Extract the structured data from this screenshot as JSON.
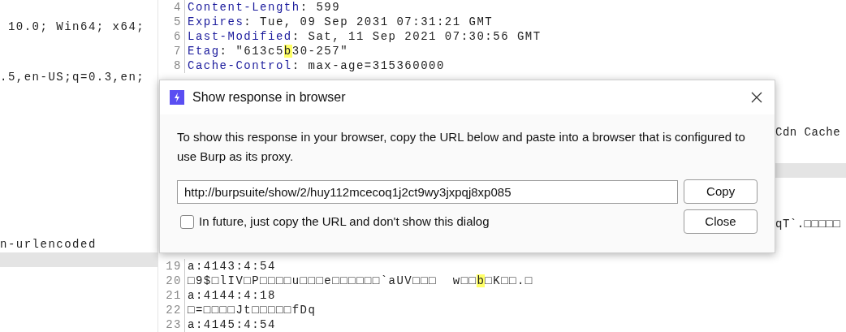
{
  "request_pane": {
    "lines": [
      {
        "text": " 10.0; Win64; x64;"
      },
      {
        "text": ".5,en-US;q=0.3,en;"
      },
      {
        "text": "n-urlencoded"
      }
    ]
  },
  "response_pane": {
    "top_lines": [
      {
        "number": "4",
        "segments": [
          {
            "kind": "name",
            "text": "Content-Length"
          },
          {
            "kind": "value",
            "text": ": 599"
          }
        ]
      },
      {
        "number": "5",
        "segments": [
          {
            "kind": "name",
            "text": "Expires"
          },
          {
            "kind": "value",
            "text": ": Tue, 09 Sep 2031 07:31:21 GMT"
          }
        ]
      },
      {
        "number": "6",
        "segments": [
          {
            "kind": "name",
            "text": "Last-Modified"
          },
          {
            "kind": "value",
            "text": ": Sat, 11 Sep 2021 07:30:56 GMT"
          }
        ]
      },
      {
        "number": "7",
        "segments": [
          {
            "kind": "name",
            "text": "Etag"
          },
          {
            "kind": "value",
            "text": ": \"613c5"
          },
          {
            "kind": "match",
            "text": "b"
          },
          {
            "kind": "value",
            "text": "30-257\""
          }
        ]
      },
      {
        "number": "8",
        "segments": [
          {
            "kind": "name",
            "text": "Cache-Control"
          },
          {
            "kind": "value",
            "text": ": max-age=315360000"
          }
        ]
      }
    ],
    "right_fragments": [
      "Cdn Cache",
      "qT`.□□□□□"
    ],
    "bottom_lines": [
      {
        "number": "19",
        "segments": [
          {
            "kind": "value",
            "text": "a:4143:4:54"
          }
        ]
      },
      {
        "number": "20",
        "segments": [
          {
            "kind": "value",
            "text": "□9$□lIV□P□□□□u□□□e□□□□□□`aUV□□□  w□□"
          },
          {
            "kind": "match",
            "text": "b"
          },
          {
            "kind": "value",
            "text": "□K□□.□"
          }
        ]
      },
      {
        "number": "21",
        "segments": [
          {
            "kind": "value",
            "text": "a:4144:4:18"
          }
        ]
      },
      {
        "number": "22",
        "segments": [
          {
            "kind": "value",
            "text": "□=□□□□Jt□□□□□fDq"
          }
        ]
      },
      {
        "number": "23",
        "segments": [
          {
            "kind": "value",
            "text": "a:4145:4:54"
          }
        ]
      }
    ]
  },
  "dialog": {
    "title": "Show response in browser",
    "message": "To show this response in your browser, copy the URL below and paste into a browser that is configured to use Burp as its proxy.",
    "url": "http://burpsuite/show/2/huy112mcecoq1j2ct9wy3jxpqj8xp085",
    "copy_button": "Copy",
    "close_button": "Close",
    "checkbox": {
      "label": "In future, just copy the URL and don't show this dialog",
      "checked": false
    }
  }
}
